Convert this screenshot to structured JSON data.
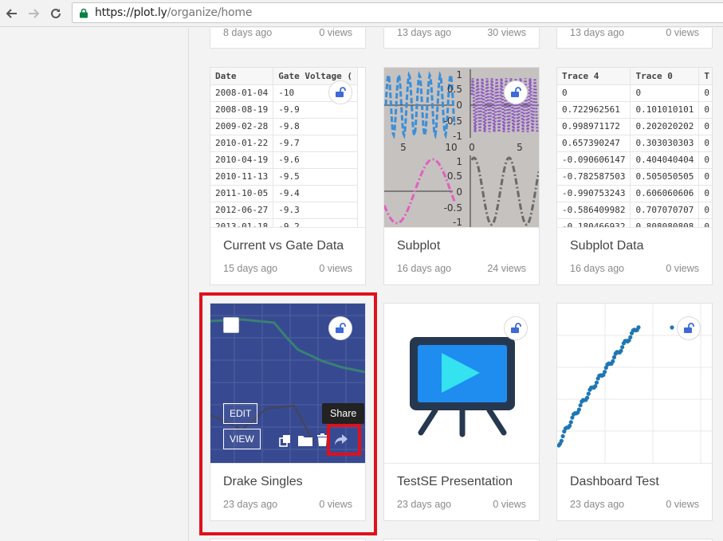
{
  "browser": {
    "url_host": "https://plot.ly",
    "url_path": "/organize/home"
  },
  "top_row": [
    {
      "date": "8 days ago",
      "views": "0 views"
    },
    {
      "date": "13 days ago",
      "views": "30 views"
    },
    {
      "date": "13 days ago",
      "views": "0 views"
    }
  ],
  "cards": [
    {
      "title": "Current vs Gate Data",
      "date": "15 days ago",
      "views": "0 views"
    },
    {
      "title": "Subplot",
      "date": "16 days ago",
      "views": "24 views"
    },
    {
      "title": "Subplot Data",
      "date": "16 days ago",
      "views": "0 views"
    },
    {
      "title": "Drake Singles",
      "date": "23 days ago",
      "views": "0 views"
    },
    {
      "title": "TestSE Presentation",
      "date": "23 days ago",
      "views": "0 views"
    },
    {
      "title": "Dashboard Test",
      "date": "23 days ago",
      "views": "0 views"
    }
  ],
  "gate_table": {
    "headers": [
      "Date",
      "Gate Voltage ("
    ],
    "rows": [
      [
        "2008-01-04",
        "-10"
      ],
      [
        "2008-08-19",
        "-9.9"
      ],
      [
        "2009-02-28",
        "-9.8"
      ],
      [
        "2010-01-22",
        "-9.7"
      ],
      [
        "2010-04-19",
        "-9.6"
      ],
      [
        "2010-11-13",
        "-9.5"
      ],
      [
        "2011-10-05",
        "-9.4"
      ],
      [
        "2012-06-27",
        "-9.3"
      ],
      [
        "2013-01-18",
        "-9.2"
      ]
    ]
  },
  "subplot_table": {
    "headers": [
      "Trace 4",
      "Trace 0",
      "T"
    ],
    "rows": [
      [
        "0",
        "0",
        "0"
      ],
      [
        "0.722962561",
        "0.101010101",
        "0"
      ],
      [
        "0.998971172",
        "0.202020202",
        "0"
      ],
      [
        "0.657390247",
        "0.303030303",
        "0"
      ],
      [
        "-0.090606147",
        "0.404040404",
        "0"
      ],
      [
        "-0.782587503",
        "0.505050505",
        "0"
      ],
      [
        "-0.990753243",
        "0.606060606",
        "0"
      ],
      [
        "-0.586409982",
        "0.707070707",
        "0"
      ],
      [
        "-0.180466932",
        "0.808080808",
        "0"
      ]
    ]
  },
  "subplot_ticks": {
    "y_top": [
      "1",
      "0.5",
      "0",
      "-0.5",
      "-1"
    ],
    "x_left": [
      "5",
      "10"
    ],
    "x_right": [
      "0",
      "5"
    ]
  },
  "hover": {
    "edit_label": "EDIT",
    "view_label": "VIEW",
    "share_tooltip": "Share"
  },
  "colors": {
    "plotly_blue": "#3d6ad6",
    "highlight_red": "#e0101c",
    "drake_bg": "#3b4f9b"
  }
}
